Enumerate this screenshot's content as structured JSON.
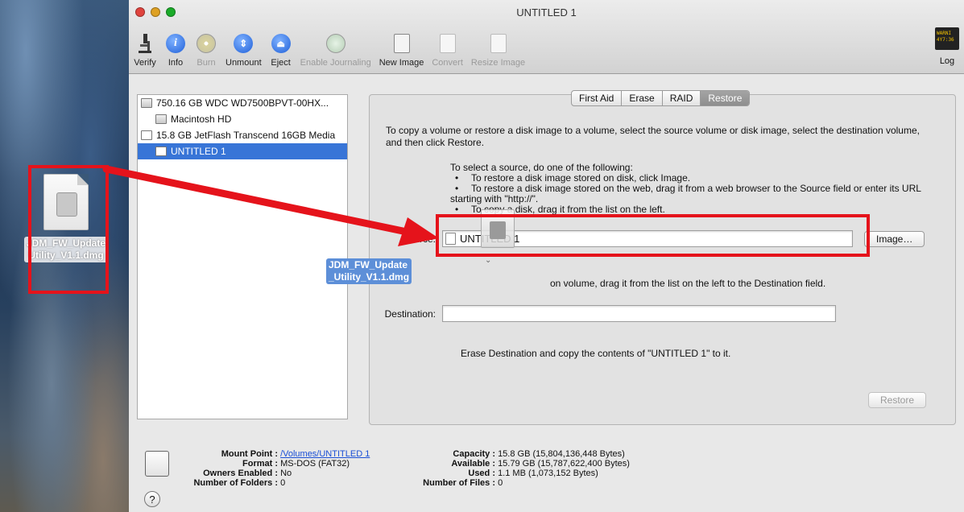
{
  "window": {
    "title": "UNTITLED 1"
  },
  "toolbar": {
    "items": [
      {
        "label": "Verify",
        "icon": "microscope-icon",
        "enabled": true
      },
      {
        "label": "Info",
        "icon": "info-icon",
        "enabled": true
      },
      {
        "label": "Burn",
        "icon": "burn-icon",
        "enabled": false
      },
      {
        "label": "Unmount",
        "icon": "unmount-icon",
        "enabled": true
      },
      {
        "label": "Eject",
        "icon": "eject-icon",
        "enabled": true
      },
      {
        "label": "Enable Journaling",
        "icon": "journaling-icon",
        "enabled": false
      },
      {
        "label": "New Image",
        "icon": "new-image-icon",
        "enabled": true
      },
      {
        "label": "Convert",
        "icon": "convert-icon",
        "enabled": false
      },
      {
        "label": "Resize Image",
        "icon": "resize-image-icon",
        "enabled": false
      }
    ],
    "log_label": "Log",
    "log_lcd": "WARNII\n4Y7:36"
  },
  "sidebar": {
    "items": [
      {
        "label": "750.16 GB WDC WD7500BPVT-00HX..."
      },
      {
        "label": "Macintosh HD"
      },
      {
        "label": "15.8 GB JetFlash Transcend 16GB Media"
      },
      {
        "label": "UNTITLED 1"
      }
    ]
  },
  "tabs": [
    "First Aid",
    "Erase",
    "RAID",
    "Restore"
  ],
  "restore": {
    "intro": "To copy a volume or restore a disk image to a volume, select the source volume or disk image, select the destination volume, and then click Restore.",
    "select_source": "To select a source, do one of the following:",
    "bullet1": "To restore a disk image stored on disk, click Image.",
    "bullet2": "To restore a disk image stored on the web, drag it from a web browser to the Source field or enter its URL starting with \"http://\".",
    "bullet3": "To copy a disk, drag it from the list on the left.",
    "source_label": "Source:",
    "source_value": "UNTITLED 1",
    "image_button": "Image…",
    "dest_instruction": "on volume, drag it from the list on the left to the Destination field.",
    "destination_label": "Destination:",
    "destination_value": "",
    "erase_note": "Erase Destination and copy the contents of \"UNTITLED 1\" to it.",
    "restore_button": "Restore"
  },
  "drag": {
    "tag_line1": "JDM_FW_Update",
    "tag_line2": "_Utility_V1.1.dmg"
  },
  "desktop_file": {
    "line1": "JDM_FW_Update",
    "line2": "Utility_V1.1.dmg"
  },
  "info": {
    "mount_point_label": "Mount Point :",
    "mount_point_value": "/Volumes/UNTITLED 1",
    "format_label": "Format :",
    "format_value": "MS-DOS (FAT32)",
    "owners_label": "Owners Enabled :",
    "owners_value": "No",
    "folders_label": "Number of Folders :",
    "folders_value": "0",
    "capacity_label": "Capacity :",
    "capacity_value": "15.8 GB (15,804,136,448 Bytes)",
    "available_label": "Available :",
    "available_value": "15.79 GB (15,787,622,400 Bytes)",
    "used_label": "Used :",
    "used_value": "1.1 MB (1,073,152 Bytes)",
    "files_label": "Number of Files :",
    "files_value": "0",
    "help_glyph": "?"
  },
  "colors": {
    "annotation_red": "#e5131b",
    "selection_blue": "#3875d7",
    "link_blue": "#1a4fd6"
  }
}
